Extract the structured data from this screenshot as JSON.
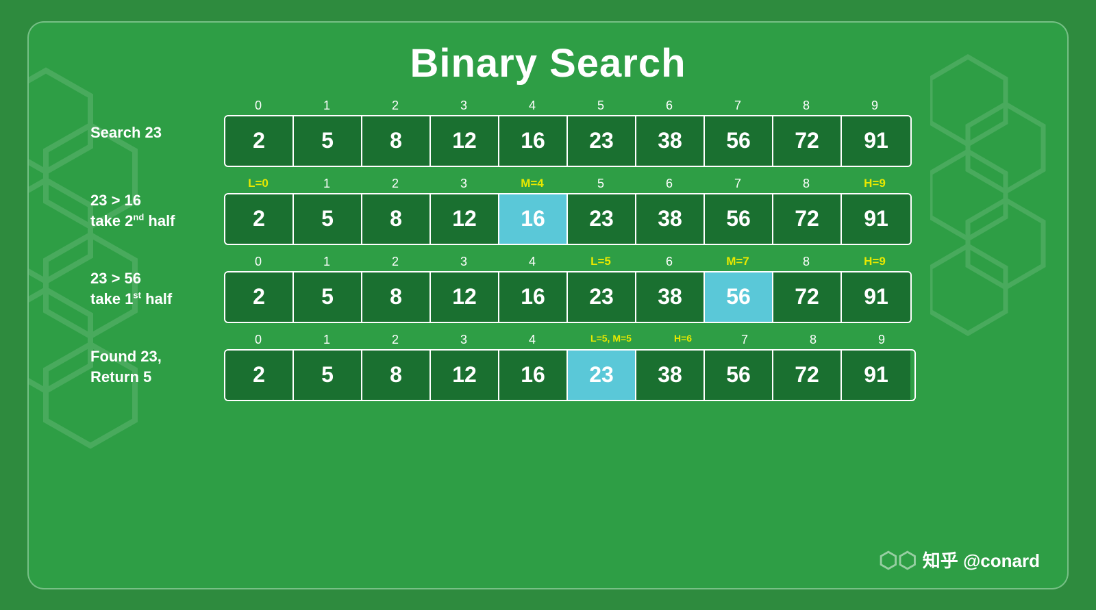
{
  "title": "Binary Search",
  "watermark": "知乎 @conard",
  "rows": [
    {
      "id": "search23",
      "label": "Search 23",
      "label_sup": null,
      "indices": [
        {
          "val": "0",
          "type": "normal"
        },
        {
          "val": "1",
          "type": "normal"
        },
        {
          "val": "2",
          "type": "normal"
        },
        {
          "val": "3",
          "type": "normal"
        },
        {
          "val": "4",
          "type": "normal"
        },
        {
          "val": "5",
          "type": "normal"
        },
        {
          "val": "6",
          "type": "normal"
        },
        {
          "val": "7",
          "type": "normal"
        },
        {
          "val": "8",
          "type": "normal"
        },
        {
          "val": "9",
          "type": "normal"
        }
      ],
      "cells": [
        {
          "val": "2",
          "type": "normal"
        },
        {
          "val": "5",
          "type": "normal"
        },
        {
          "val": "8",
          "type": "normal"
        },
        {
          "val": "12",
          "type": "normal"
        },
        {
          "val": "16",
          "type": "normal"
        },
        {
          "val": "23",
          "type": "normal"
        },
        {
          "val": "38",
          "type": "normal"
        },
        {
          "val": "56",
          "type": "normal"
        },
        {
          "val": "72",
          "type": "normal"
        },
        {
          "val": "91",
          "type": "normal"
        }
      ]
    },
    {
      "id": "step1",
      "label": "23 > 16",
      "label2": "take 2",
      "label2_sup": "nd",
      "label2_rest": " half",
      "indices": [
        {
          "val": "L=0",
          "type": "yellow"
        },
        {
          "val": "1",
          "type": "normal"
        },
        {
          "val": "2",
          "type": "normal"
        },
        {
          "val": "3",
          "type": "normal"
        },
        {
          "val": "M=4",
          "type": "yellow"
        },
        {
          "val": "5",
          "type": "normal"
        },
        {
          "val": "6",
          "type": "normal"
        },
        {
          "val": "7",
          "type": "normal"
        },
        {
          "val": "8",
          "type": "normal"
        },
        {
          "val": "H=9",
          "type": "yellow"
        }
      ],
      "cells": [
        {
          "val": "2",
          "type": "normal"
        },
        {
          "val": "5",
          "type": "normal"
        },
        {
          "val": "8",
          "type": "normal"
        },
        {
          "val": "12",
          "type": "normal"
        },
        {
          "val": "16",
          "type": "highlight-blue"
        },
        {
          "val": "23",
          "type": "normal"
        },
        {
          "val": "38",
          "type": "normal"
        },
        {
          "val": "56",
          "type": "normal"
        },
        {
          "val": "72",
          "type": "normal"
        },
        {
          "val": "91",
          "type": "normal"
        }
      ]
    },
    {
      "id": "step2",
      "label": "23 > 56",
      "label2": "take 1",
      "label2_sup": "st",
      "label2_rest": " half",
      "indices": [
        {
          "val": "0",
          "type": "normal"
        },
        {
          "val": "1",
          "type": "normal"
        },
        {
          "val": "2",
          "type": "normal"
        },
        {
          "val": "3",
          "type": "normal"
        },
        {
          "val": "4",
          "type": "normal"
        },
        {
          "val": "L=5",
          "type": "yellow"
        },
        {
          "val": "6",
          "type": "normal"
        },
        {
          "val": "M=7",
          "type": "yellow"
        },
        {
          "val": "8",
          "type": "normal"
        },
        {
          "val": "H=9",
          "type": "yellow"
        }
      ],
      "cells": [
        {
          "val": "2",
          "type": "normal"
        },
        {
          "val": "5",
          "type": "normal"
        },
        {
          "val": "8",
          "type": "normal"
        },
        {
          "val": "12",
          "type": "normal"
        },
        {
          "val": "16",
          "type": "normal"
        },
        {
          "val": "23",
          "type": "normal"
        },
        {
          "val": "38",
          "type": "normal"
        },
        {
          "val": "56",
          "type": "highlight-blue"
        },
        {
          "val": "72",
          "type": "normal"
        },
        {
          "val": "91",
          "type": "normal"
        }
      ]
    },
    {
      "id": "step3",
      "label": "Found 23,",
      "label2": "Return 5",
      "label2_sup": null,
      "label2_rest": "",
      "indices": [
        {
          "val": "0",
          "type": "normal"
        },
        {
          "val": "1",
          "type": "normal"
        },
        {
          "val": "2",
          "type": "normal"
        },
        {
          "val": "3",
          "type": "normal"
        },
        {
          "val": "4",
          "type": "normal"
        },
        {
          "val": "L=5, M=5",
          "type": "yellow"
        },
        {
          "val": "H=6",
          "type": "yellow"
        },
        {
          "val": "7",
          "type": "normal"
        },
        {
          "val": "8",
          "type": "normal"
        },
        {
          "val": "9",
          "type": "normal"
        }
      ],
      "cells": [
        {
          "val": "2",
          "type": "normal"
        },
        {
          "val": "5",
          "type": "normal"
        },
        {
          "val": "8",
          "type": "normal"
        },
        {
          "val": "12",
          "type": "normal"
        },
        {
          "val": "16",
          "type": "normal"
        },
        {
          "val": "23",
          "type": "highlight-blue"
        },
        {
          "val": "38",
          "type": "normal"
        },
        {
          "val": "56",
          "type": "normal"
        },
        {
          "val": "72",
          "type": "normal"
        },
        {
          "val": "91",
          "type": "normal"
        }
      ]
    }
  ]
}
